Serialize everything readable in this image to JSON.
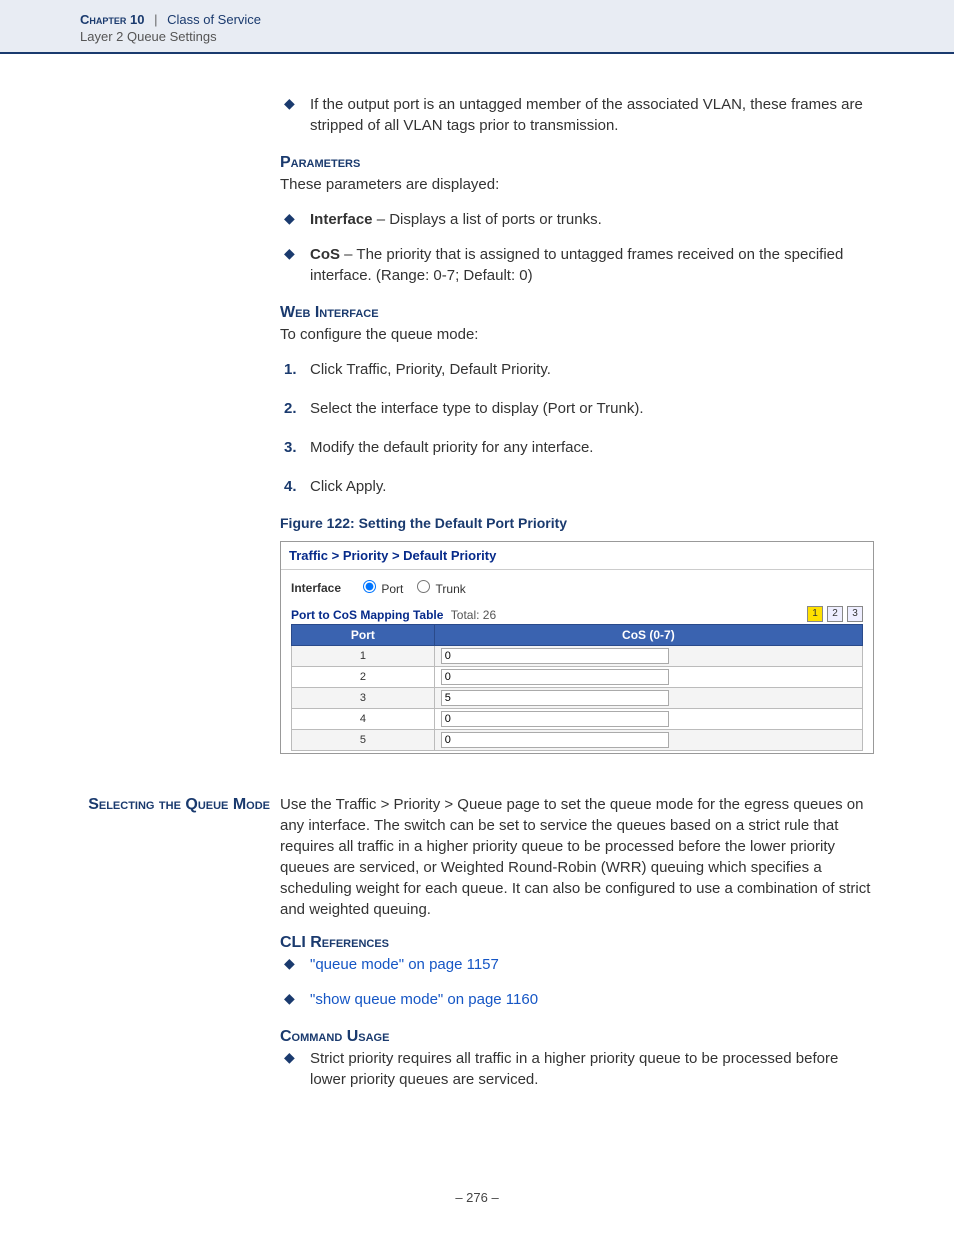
{
  "header": {
    "chapter_label": "Chapter 10",
    "chapter_title": "Class of Service",
    "sub": "Layer 2 Queue Settings"
  },
  "intro_bullet": "If the output port is an untagged member of the associated VLAN, these frames are stripped of all VLAN tags prior to transmission.",
  "parameters": {
    "head": "Parameters",
    "intro": "These parameters are displayed:",
    "items": [
      {
        "name": "Interface",
        "desc": " – Displays a list of ports or trunks."
      },
      {
        "name": "CoS",
        "desc": " – The priority that is assigned to untagged frames received on the specified interface. (Range: 0-7; Default: 0)"
      }
    ]
  },
  "webif": {
    "head": "Web Interface",
    "intro": "To configure the queue mode:",
    "steps": [
      "Click Traffic, Priority, Default Priority.",
      "Select the interface type to display (Port or Trunk).",
      "Modify the default priority for any interface.",
      "Click Apply."
    ]
  },
  "figure": {
    "caption": "Figure 122:  Setting the Default Port Priority",
    "breadcrumb": "Traffic > Priority > Default Priority",
    "iface_label": "Interface",
    "radio_port": "Port",
    "radio_trunk": "Trunk",
    "table_title": "Port to CoS Mapping Table",
    "total_label": "Total: 26",
    "pager": [
      "1",
      "2",
      "3"
    ],
    "cols": {
      "port": "Port",
      "cos": "CoS (0-7)"
    },
    "rows": [
      {
        "port": "1",
        "cos": "0"
      },
      {
        "port": "2",
        "cos": "0"
      },
      {
        "port": "3",
        "cos": "5"
      },
      {
        "port": "4",
        "cos": "0"
      },
      {
        "port": "5",
        "cos": "0"
      }
    ]
  },
  "section2": {
    "side": "Selecting the Queue Mode",
    "para": "Use the Traffic > Priority > Queue page to set the queue mode for the egress queues on any interface. The switch can be set to service the queues based on a strict rule that requires all traffic in a higher priority queue to be processed before the lower priority queues are serviced, or Weighted Round-Robin (WRR) queuing which specifies a scheduling weight for each queue. It can also be configured to use a combination of strict and weighted queuing.",
    "cli_head": "CLI References",
    "cli_refs": [
      "\"queue mode\" on page 1157",
      "\"show queue mode\" on page 1160"
    ],
    "cmd_head": "Command Usage",
    "cmd_bullets": [
      "Strict priority requires all traffic in a higher priority queue to be processed before lower priority queues are serviced."
    ]
  },
  "page_number": "–  276  –"
}
